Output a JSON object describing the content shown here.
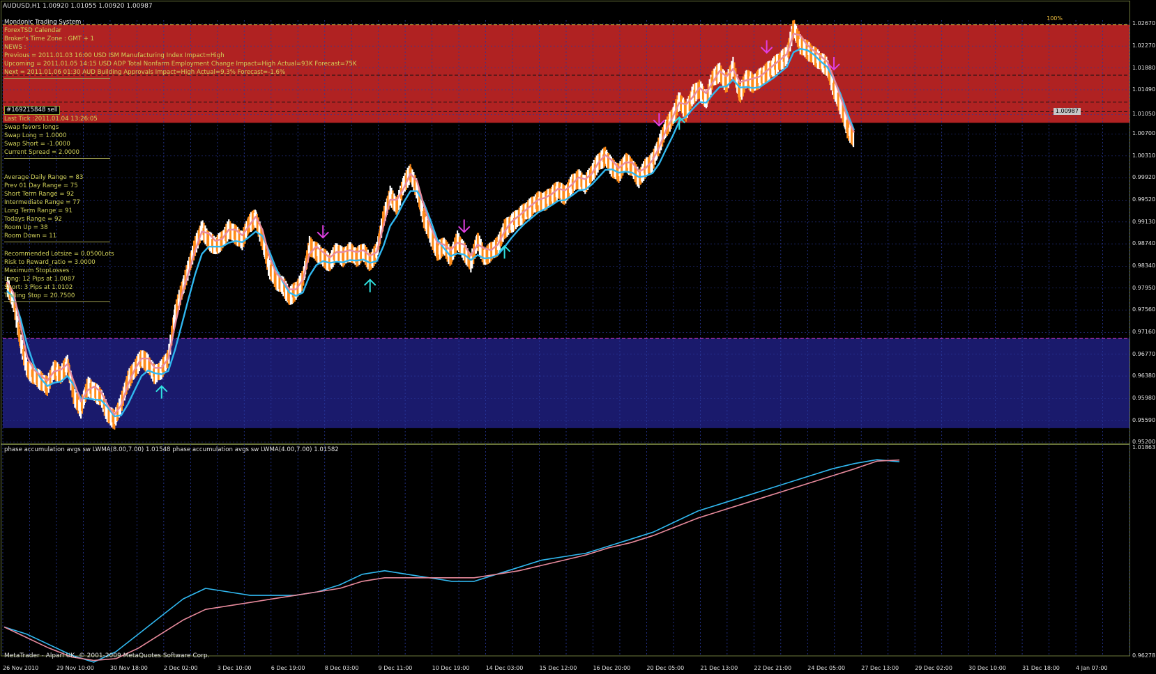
{
  "window": {
    "title": "AUDUSD,H1  1.00920 1.01055 1.00920 1.00987"
  },
  "colors": {
    "background": "#000000",
    "resistance_zone": "#b02222",
    "support_zone": "#1a1a6c",
    "bull_candle": "#ffffff",
    "bear_candle": "#ff8c1a",
    "fast_ma": "#30b8f0",
    "slow_ma": "#e88a9c",
    "sell_arrow": "#e040e0",
    "buy_arrow": "#30e0e0",
    "grid": "#2a3aa0",
    "frame": "#6e7a3c"
  },
  "info_panel": {
    "header": [
      "Mondonic Trading System",
      "ForexTSD Calendar",
      "Broker's Time Zone : GMT + 1",
      "NEWS :",
      "Previous = 2011.01.03 16:00 USD ISM Manufacturing Index Impact=High",
      "Upcoming = 2011.01.05 14:15 USD ADP Total Nonfarm Employment Change Impact=High Actual=93K Forecast=75K",
      "Next = 2011.01.06 01:30 AUD Building Approvals Impact=High Actual=9.3% Forecast=-1.6%"
    ],
    "order_tag": "#169215848 sell",
    "tick_info": [
      "Last Tick :2011.01.04 13:26:05",
      "Swap favors longs",
      "Swap Long = 1.0000",
      "Swap Short = -1.0000",
      "Current Spread = 2.0000"
    ],
    "ranges": [
      "Average Daily Range = 83",
      "Prev 01 Day Range = 75",
      "Short Term Range = 92",
      "Intermediate Range = 77",
      "Long Term Range = 91",
      "Todays Range = 92",
      "Room Up = 38",
      "Room Down = 11"
    ],
    "risk": [
      "Recommended Lotsize =   0.0500Lots",
      "Risk to Reward_ratio =  3.0000",
      "Maximum StopLosses :",
      "Long:  12 Pips at 1.0087",
      "Short: 3 Pips at 1.0102",
      "Trailing Stop = 20.7500"
    ]
  },
  "chart_data": [
    {
      "type": "line",
      "name": "price_chart",
      "symbol_label": "AUDUSD,H1",
      "percent_label": "100%",
      "current_price_label": "1.00987",
      "y_tick_labels": [
        "1.02670",
        "1.02270",
        "1.01880",
        "1.01490",
        "1.01050",
        "1.00700",
        "1.00310",
        "0.99920",
        "0.99520",
        "0.99130",
        "0.98740",
        "0.98340",
        "0.97950",
        "0.97560",
        "0.97160",
        "0.96770",
        "0.96380",
        "0.95980",
        "0.95590",
        "0.95200"
      ],
      "ylim": [
        0.952,
        1.0267
      ],
      "x_tick_labels": [
        "26 Nov 2010",
        "29 Nov 10:00",
        "30 Nov 18:00",
        "2 Dec 02:00",
        "3 Dec 10:00",
        "6 Dec 19:00",
        "8 Dec 03:00",
        "9 Dec 11:00",
        "10 Dec 19:00",
        "14 Dec 03:00",
        "15 Dec 12:00",
        "16 Dec 20:00",
        "20 Dec 05:00",
        "21 Dec 13:00",
        "22 Dec 21:00",
        "24 Dec 05:00",
        "27 Dec 13:00",
        "29 Dec 02:00",
        "30 Dec 10:00",
        "31 Dec 18:00",
        "4 Jan 07:00"
      ],
      "zones": [
        {
          "type": "resistance",
          "from": 1.009,
          "to": 1.0265
        },
        {
          "type": "support",
          "from": 0.9545,
          "to": 0.9705
        }
      ],
      "horizontal_levels": [
        1.0265,
        1.0175,
        1.0127,
        1.011,
        0.9705
      ],
      "price_path": [
        0.98,
        0.977,
        0.97,
        0.965,
        0.964,
        0.963,
        0.962,
        0.965,
        0.964,
        0.966,
        0.96,
        0.958,
        0.962,
        0.961,
        0.96,
        0.957,
        0.956,
        0.959,
        0.963,
        0.965,
        0.967,
        0.966,
        0.964,
        0.965,
        0.967,
        0.975,
        0.979,
        0.983,
        0.987,
        0.99,
        0.988,
        0.987,
        0.988,
        0.99,
        0.989,
        0.988,
        0.991,
        0.992,
        0.988,
        0.983,
        0.981,
        0.98,
        0.978,
        0.979,
        0.981,
        0.987,
        0.986,
        0.985,
        0.984,
        0.986,
        0.985,
        0.986,
        0.985,
        0.986,
        0.984,
        0.986,
        0.992,
        0.996,
        0.994,
        0.998,
        1.0,
        0.997,
        0.992,
        0.989,
        0.986,
        0.987,
        0.985,
        0.988,
        0.986,
        0.984,
        0.988,
        0.985,
        0.986,
        0.987,
        0.99,
        0.991,
        0.992,
        0.993,
        0.994,
        0.995,
        0.995,
        0.996,
        0.997,
        0.996,
        0.998,
        0.999,
        0.998,
        1.0,
        1.002,
        1.003,
        1.001,
        1.0,
        1.002,
        1.001,
        0.999,
        1.001,
        1.002,
        1.005,
        1.008,
        1.01,
        1.013,
        1.011,
        1.014,
        1.015,
        1.013,
        1.017,
        1.018,
        1.016,
        1.019,
        1.014,
        1.017,
        1.016,
        1.017,
        1.018,
        1.019,
        1.02,
        1.021,
        1.026,
        1.023,
        1.022,
        1.021,
        1.02,
        1.019,
        1.015,
        1.012,
        1.008,
        1.006
      ],
      "series": [
        {
          "name": "fast_ma",
          "color": "#30b8f0",
          "offset_from_price": -0.001
        },
        {
          "name": "slow_ma",
          "color": "#e88a9c",
          "offset_from_price": 0.0006
        }
      ],
      "signals": [
        {
          "type": "buy",
          "at_index": 23
        },
        {
          "type": "sell",
          "at_index": 47
        },
        {
          "type": "buy",
          "at_index": 54
        },
        {
          "type": "sell",
          "at_index": 68
        },
        {
          "type": "buy",
          "at_index": 74
        },
        {
          "type": "sell",
          "at_index": 97
        },
        {
          "type": "buy",
          "at_index": 100
        },
        {
          "type": "sell",
          "at_index": 113
        },
        {
          "type": "sell",
          "at_index": 123
        }
      ]
    },
    {
      "type": "line",
      "name": "indicator",
      "title": "phase accumulation avgs sw LWMA(8.00,7.00) 1.01548  phase accumulation avgs sw LWMA(4.00,7.00) 1.01582",
      "y_tick_labels": [
        "1.01863",
        "0.96278"
      ],
      "ylim": [
        0.96278,
        1.01863
      ],
      "series": [
        {
          "name": "LWMA(8.00,7.00)",
          "color": "#30b8f0",
          "values": [
            0.971,
            0.969,
            0.966,
            0.963,
            0.961,
            0.964,
            0.969,
            0.974,
            0.979,
            0.982,
            0.981,
            0.98,
            0.98,
            0.98,
            0.981,
            0.983,
            0.986,
            0.987,
            0.986,
            0.985,
            0.984,
            0.984,
            0.986,
            0.988,
            0.99,
            0.991,
            0.992,
            0.994,
            0.996,
            0.998,
            1.001,
            1.004,
            1.006,
            1.008,
            1.01,
            1.012,
            1.014,
            1.016,
            1.0175,
            1.0186,
            1.018
          ]
        },
        {
          "name": "LWMA(4.00,7.00)",
          "color": "#e88a9c",
          "values": [
            0.971,
            0.968,
            0.965,
            0.9625,
            0.9615,
            0.962,
            0.965,
            0.969,
            0.973,
            0.976,
            0.977,
            0.978,
            0.979,
            0.98,
            0.981,
            0.982,
            0.984,
            0.985,
            0.985,
            0.985,
            0.985,
            0.985,
            0.986,
            0.987,
            0.9885,
            0.99,
            0.9915,
            0.9935,
            0.995,
            0.997,
            0.9995,
            1.002,
            1.004,
            1.006,
            1.008,
            1.01,
            1.012,
            1.014,
            1.016,
            1.0182,
            1.0185
          ]
        }
      ]
    }
  ],
  "copyright": "MetaTrader - Alpari UK, © 2001-2009 MetaQuotes Software Corp."
}
